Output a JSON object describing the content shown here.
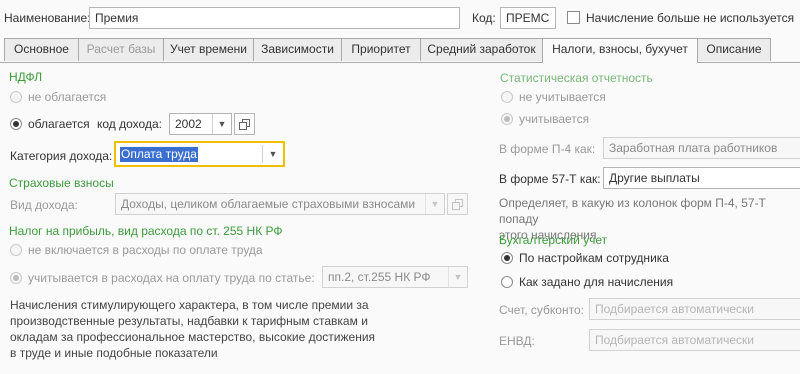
{
  "header": {
    "name_label": "Наименование:",
    "name_value": "Премия",
    "code_label": "Код:",
    "code_value": "ПРЕМС",
    "not_used_label": "Начисление больше не используется"
  },
  "tabs": [
    {
      "label": "Основное"
    },
    {
      "label": "Расчет базы"
    },
    {
      "label": "Учет времени"
    },
    {
      "label": "Зависимости"
    },
    {
      "label": "Приоритет"
    },
    {
      "label": "Средний заработок"
    },
    {
      "label": "Налоги, взносы, бухучет"
    },
    {
      "label": "Описание"
    }
  ],
  "ndfl": {
    "title": "НДФЛ",
    "not_taxed_label": "не облагается",
    "taxed_label": "облагается",
    "income_code_label": "код дохода:",
    "income_code_value": "2002",
    "category_label": "Категория дохода:",
    "category_value": "Оплата труда"
  },
  "insurance": {
    "title": "Страховые взносы",
    "income_type_label": "Вид дохода:",
    "income_type_value": "Доходы, целиком облагаемые страховыми взносами"
  },
  "profit_tax": {
    "title": "Налог на прибыль, вид расхода по ст. 255 НК РФ",
    "not_included_label": "не включается в расходы по оплате труда",
    "included_label": "учитывается в расходах на оплату труда по статье:",
    "article_value": "пп.2, ст.255 НК РФ",
    "note": "Начисления стимулирующего характера, в том числе премии за\nпроизводственные результаты, надбавки к тарифным ставкам и\nокладам за профессиональное мастерство, высокие достижения\nв труде и иные подобные показатели"
  },
  "statistics": {
    "title": "Статистическая отчетность",
    "not_counted_label": "не учитывается",
    "counted_label": "учитывается",
    "p4_label": "В форме П-4 как:",
    "p4_value": "Заработная плата работников",
    "f57t_label": "В форме 57-Т как:",
    "f57t_value": "Другие выплаты",
    "note": "Определяет, в какую из колонок форм П-4, 57-Т попаду\nэтого начисления"
  },
  "accounting": {
    "title": "Бухгалтерский учет",
    "by_employee_label": "По настройкам сотрудника",
    "as_set_label": "Как задано для начисления",
    "account_label": "Счет, субконто:",
    "account_placeholder": "Подбирается автоматически",
    "envd_label": "ЕНВД:",
    "envd_placeholder": "Подбирается автоматически"
  },
  "colors": {
    "section_title": "#3c9a3c",
    "focus_border": "#f0c000",
    "selection": "#3a6fd0"
  },
  "icons": {
    "dropdown": "triangle-down",
    "open": "open-window"
  }
}
